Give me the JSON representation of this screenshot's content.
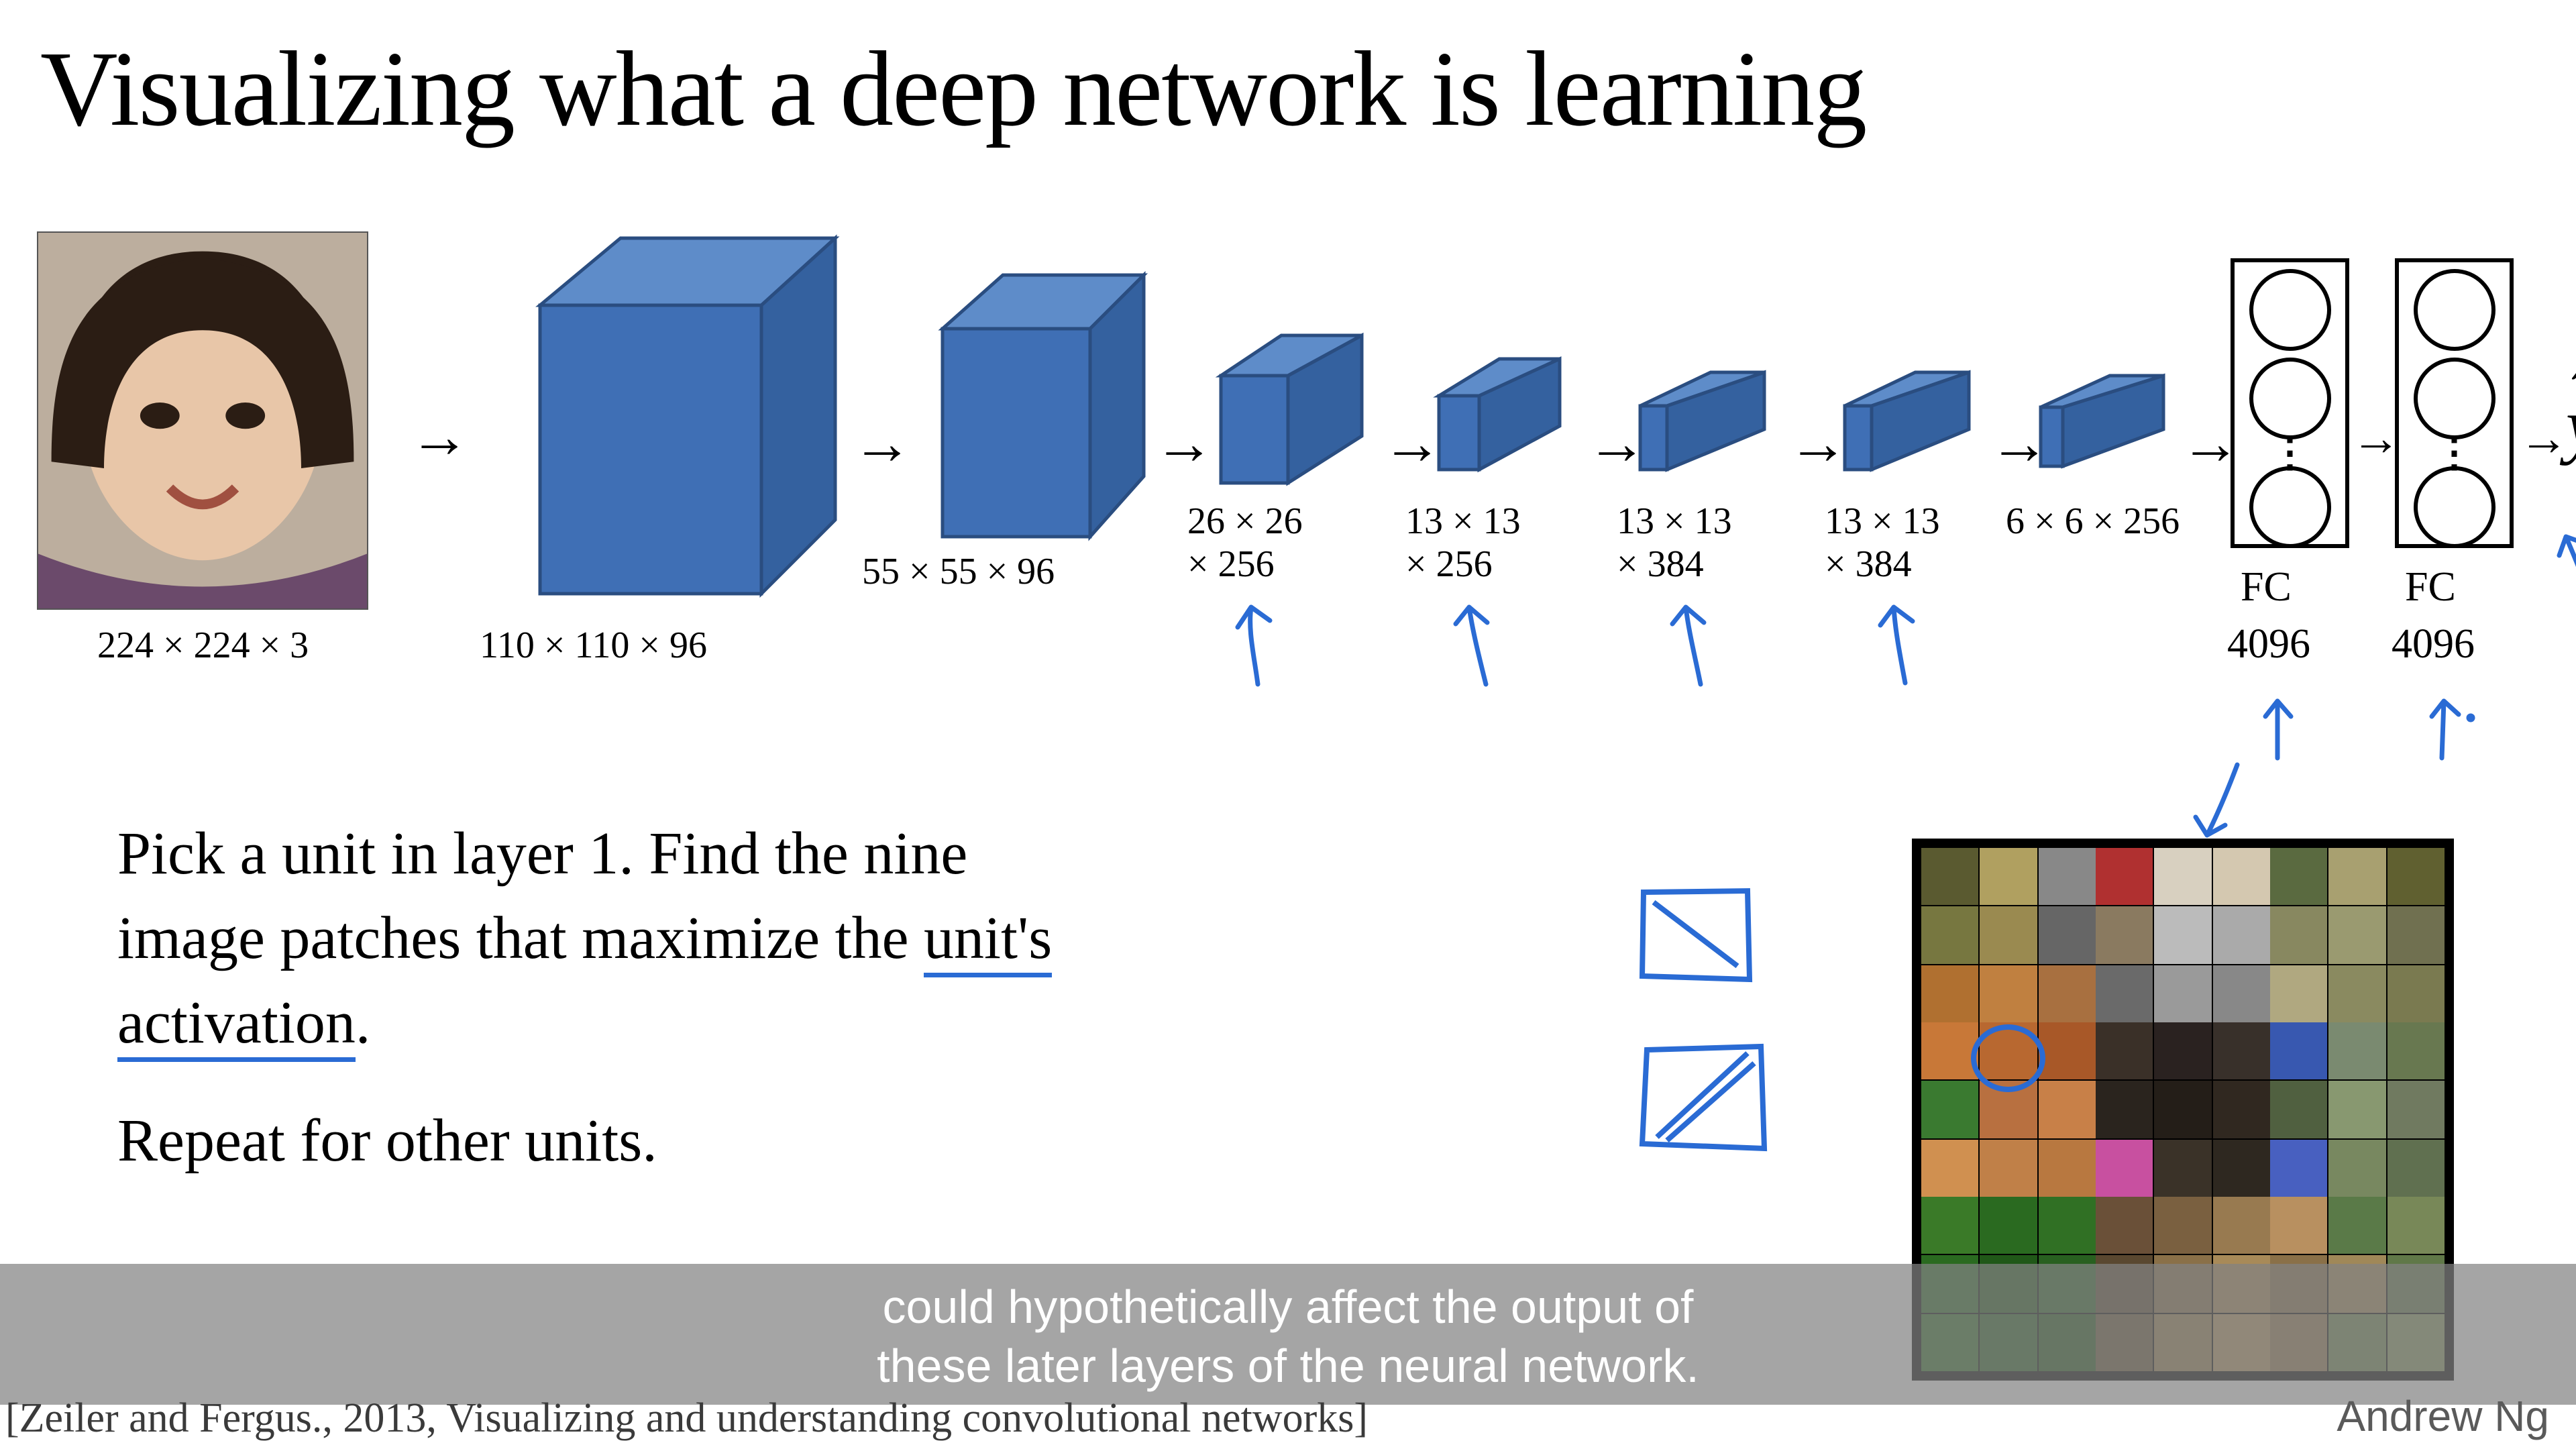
{
  "title": "Visualizing what a deep network is learning",
  "dims": {
    "input": "224 × 224 × 3",
    "l1": "110 × 110 × 96",
    "l2": "55 × 55 × 96",
    "l3": "26 × 26\n× 256",
    "l4": "13 × 13\n× 256",
    "l5": "13 × 13\n× 384",
    "l6": "13 × 13\n× 384",
    "l7": "6 × 6 × 256"
  },
  "fc": {
    "label": "FC",
    "size": "4096"
  },
  "yhat": "ŷ",
  "body": {
    "line1a": "Pick a unit in layer 1. Find the nine",
    "line2a": "image patches that maximize the ",
    "unit": "unit's",
    "activation": "activation",
    "period": ".",
    "line3": "Repeat for other units."
  },
  "caption": {
    "l1": "could hypothetically affect the output of",
    "l2": "these later layers of the neural network."
  },
  "citation": "[Zeiler and Fergus., 2013, Visualizing and understanding convolutional networks]",
  "author": "Andrew Ng",
  "arrow": "→"
}
